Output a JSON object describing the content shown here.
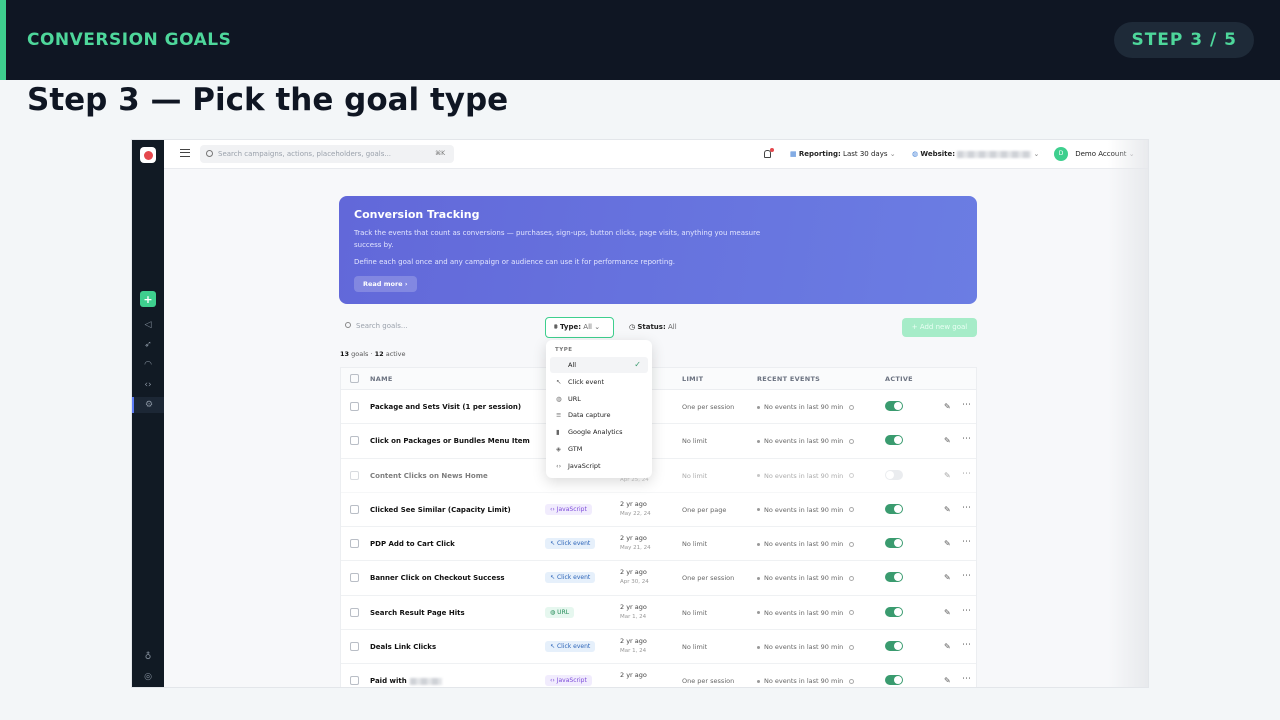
{
  "slide": {
    "section_title": "CONVERSION GOALS",
    "step_badge": "STEP 3 / 5",
    "heading": "Step 3 — Pick the goal type"
  },
  "app_header": {
    "search_placeholder": "Search campaigns, actions, placeholders, goals...",
    "search_shortcut": "⌘K",
    "reporting_label": "Reporting:",
    "reporting_value": "Last 30 days",
    "website_label": "Website:",
    "account_initial": "D",
    "account_name": "Demo Account"
  },
  "banner": {
    "title": "Conversion Tracking",
    "line1": "Track the events that count as conversions — purchases, sign-ups, button clicks, page visits, anything you measure success by.",
    "line2": "Define each goal once and any campaign or audience can use it for performance reporting.",
    "button": "Read more"
  },
  "toolbar": {
    "search_placeholder": "Search goals...",
    "type_label": "Type:",
    "type_value": "All",
    "status_label": "Status:",
    "status_value": "All",
    "add_button": "+ Add new goal"
  },
  "counts": {
    "goals": "13",
    "goals_label": "goals ·",
    "active": "12",
    "active_label": "active"
  },
  "table": {
    "columns": {
      "name": "NAME",
      "limit": "LIMIT",
      "recent_events": "RECENT EVENTS",
      "active": "ACTIVE"
    },
    "rows": [
      {
        "name": "Package and Sets Visit (1 per session)",
        "type": "",
        "updated": "",
        "updated_date": "",
        "limit": "One per session",
        "events": "No events in last 90 min",
        "active": true
      },
      {
        "name": "Click on Packages or Bundles Menu Item",
        "type": "",
        "updated": "",
        "updated_date": "",
        "limit": "No limit",
        "events": "No events in last 90 min",
        "active": true
      },
      {
        "name": "Content Clicks on News Home",
        "type": "",
        "updated": "",
        "updated_date": "Apr 25, 24",
        "limit": "No limit",
        "events": "No events in last 90 min",
        "active": false
      },
      {
        "name": "Clicked See Similar (Capacity Limit)",
        "type": "JavaScript",
        "updated": "2 yr ago",
        "updated_date": "May 22, 24",
        "limit": "One per page",
        "events": "No events in last 90 min",
        "active": true
      },
      {
        "name": "PDP Add to Cart Click",
        "type": "Click event",
        "updated": "2 yr ago",
        "updated_date": "May 21, 24",
        "limit": "No limit",
        "events": "No events in last 90 min",
        "active": true
      },
      {
        "name": "Banner Click on Checkout Success",
        "type": "Click event",
        "updated": "2 yr ago",
        "updated_date": "Apr 30, 24",
        "limit": "One per session",
        "events": "No events in last 90 min",
        "active": true
      },
      {
        "name": "Search Result Page Hits",
        "type": "URL",
        "updated": "2 yr ago",
        "updated_date": "Mar 1, 24",
        "limit": "No limit",
        "events": "No events in last 90 min",
        "active": true
      },
      {
        "name": "Deals Link Clicks",
        "type": "Click event",
        "updated": "2 yr ago",
        "updated_date": "Mar 1, 24",
        "limit": "No limit",
        "events": "No events in last 90 min",
        "active": true
      },
      {
        "name": "Paid with",
        "type": "JavaScript",
        "updated": "2 yr ago",
        "updated_date": "",
        "limit": "One per session",
        "events": "No events in last 90 min",
        "active": true
      }
    ]
  },
  "type_dropdown": {
    "header": "TYPE",
    "options": [
      {
        "label": "All",
        "icon": "none",
        "selected": true
      },
      {
        "label": "Click event",
        "icon": "cursor-icon"
      },
      {
        "label": "URL",
        "icon": "globe-icon"
      },
      {
        "label": "Data capture",
        "icon": "lines-icon"
      },
      {
        "label": "Google Analytics",
        "icon": "bar-chart-icon"
      },
      {
        "label": "GTM",
        "icon": "gtm-icon"
      },
      {
        "label": "JavaScript",
        "icon": "code-icon"
      }
    ]
  },
  "colors": {
    "accent": "#3ecf8e",
    "dark": "#0f1623",
    "banner": "#6268d9"
  }
}
